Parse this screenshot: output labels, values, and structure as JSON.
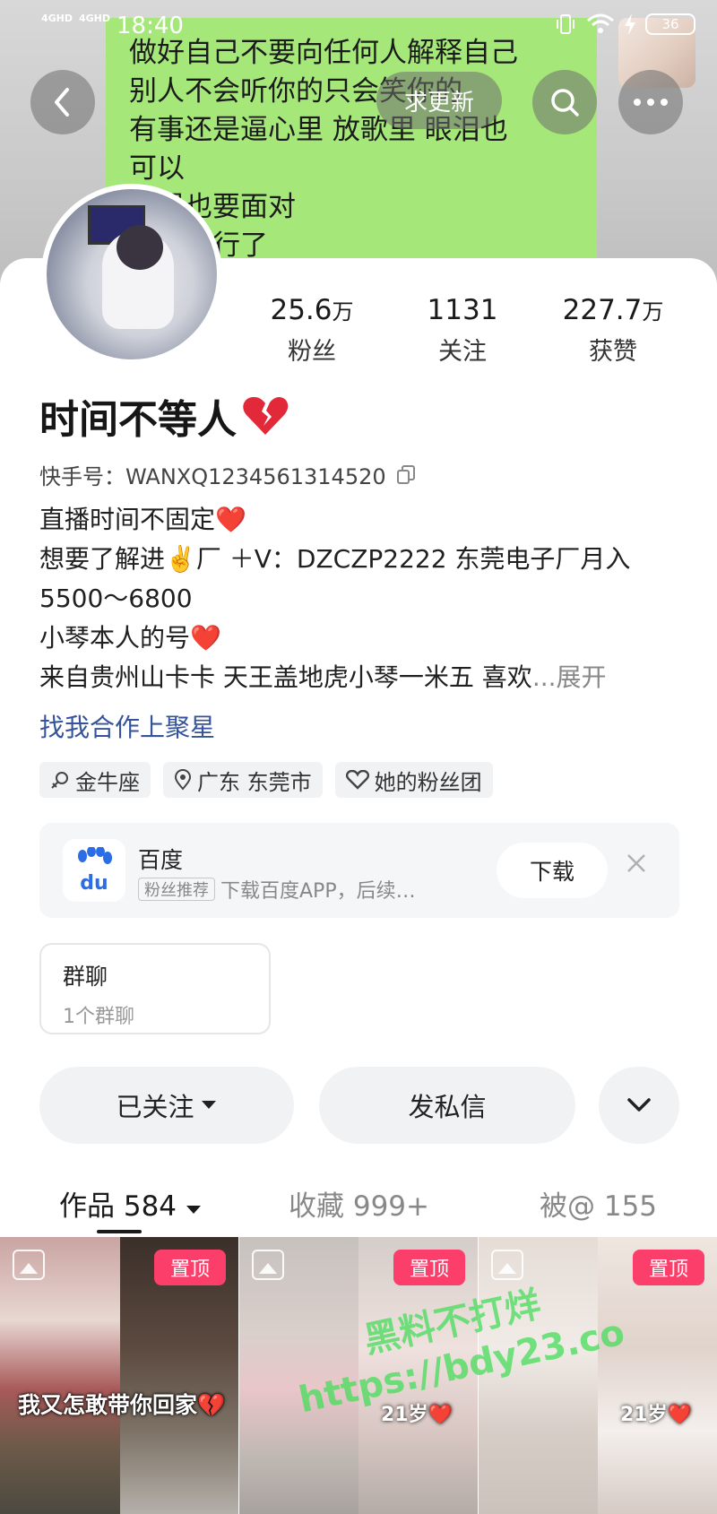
{
  "status_bar": {
    "signal_left": "4GHD",
    "signal_right": "4GHD",
    "time": "18:40",
    "battery": "36"
  },
  "cover": {
    "note_lines": [
      "做好自己不要向任何人解释自己",
      "别人不会听你的只会笑你的",
      "有事还是逼心里  放歌里  眼泪也",
      "可以",
      "  在累也要面对",
      "  己的就行了"
    ],
    "update_label": "求更新"
  },
  "stats": [
    {
      "value": "25.6",
      "unit": "万",
      "label": "粉丝"
    },
    {
      "value": "1131",
      "unit": "",
      "label": "关注"
    },
    {
      "value": "227.7",
      "unit": "万",
      "label": "获赞"
    }
  ],
  "profile": {
    "name": "时间不等人",
    "uid": "快手号：WANXQ1234561314520",
    "bio_lines": [
      "直播时间不固定❤️",
      "想要了解进✌️厂 ＋V：DZCZP2222 东莞电子厂月入",
      "5500～6800",
      "小琴本人的号❤️",
      "来自贵州山卡卡 天王盖地虎小琴一米五 喜欢"
    ],
    "bio_more": "...展开",
    "cooperation_link": "找我合作上聚星",
    "tags": [
      "金牛座",
      "广东 东莞市",
      "她的粉丝团"
    ]
  },
  "ad": {
    "logo_text": "du",
    "brand": "百度",
    "badge": "粉丝推荐",
    "desc": "下载百度APP，后续…",
    "download_label": "下载"
  },
  "group_chat": {
    "title": "群聊",
    "subtitle": "1个群聊"
  },
  "actions": {
    "follow_label": "已关注",
    "message_label": "发私信"
  },
  "tabs": [
    {
      "label": "作品 584"
    },
    {
      "label": "收藏 999+"
    },
    {
      "label": "被@ 155"
    }
  ],
  "grid": {
    "pin_label": "置顶",
    "items": [
      {
        "caption": "我又怎敢带你回家💔"
      },
      {
        "caption": "21岁❤️"
      },
      {
        "caption": "21岁❤️"
      }
    ]
  },
  "watermark": {
    "line1": "黑料不打烊",
    "line2": "https://bdy23.co"
  },
  "colors": {
    "accent_pin": "#fc3f6a",
    "link": "#34539a",
    "note_bg": "#a5e879"
  }
}
